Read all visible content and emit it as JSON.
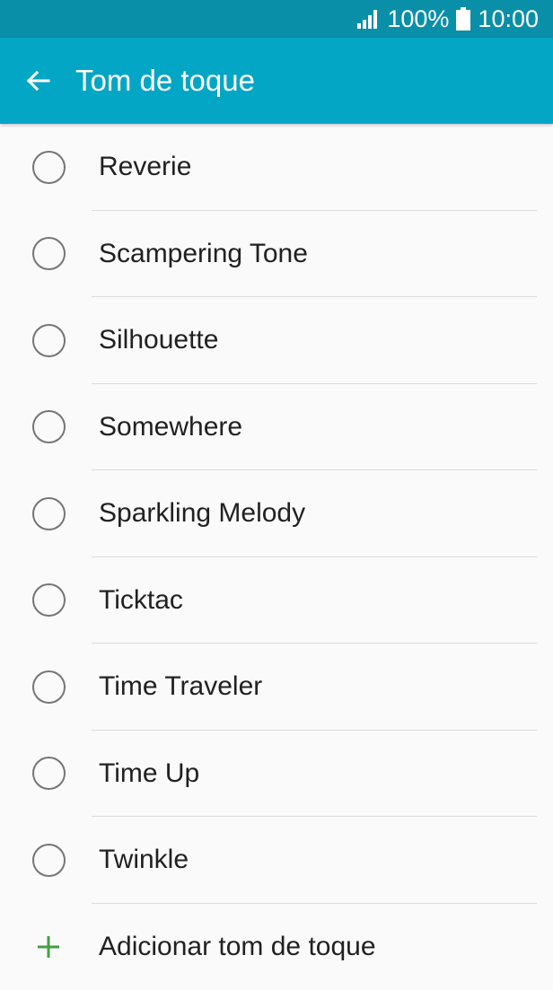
{
  "status_bar": {
    "battery_percent": "100%",
    "time": "10:00",
    "icons": [
      "signal-icon",
      "battery-icon"
    ]
  },
  "app_bar": {
    "title": "Tom de toque",
    "back_icon": "back-arrow-icon"
  },
  "ringtones": [
    {
      "label": "Reverie",
      "selected": false
    },
    {
      "label": "Scampering Tone",
      "selected": false
    },
    {
      "label": "Silhouette",
      "selected": false
    },
    {
      "label": "Somewhere",
      "selected": false
    },
    {
      "label": "Sparkling Melody",
      "selected": false
    },
    {
      "label": "Ticktac",
      "selected": false
    },
    {
      "label": "Time Traveler",
      "selected": false
    },
    {
      "label": "Time Up",
      "selected": false
    },
    {
      "label": "Twinkle",
      "selected": false
    }
  ],
  "add_ringtone": {
    "label": "Adicionar tom de toque",
    "icon": "plus-icon"
  },
  "colors": {
    "status_bar": "#0a8fa9",
    "app_bar": "#03a6c5",
    "accent_plus": "#43a047",
    "radio_border": "#757575"
  }
}
